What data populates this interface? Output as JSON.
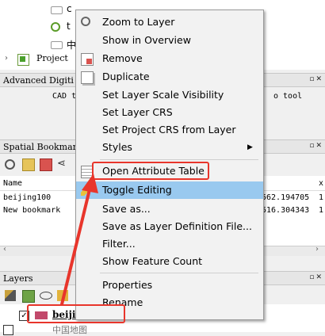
{
  "browser_tree": {
    "items": [
      "c",
      "t",
      "中",
      "Project"
    ]
  },
  "digitizing_panel": {
    "title": "Advanced Digiti",
    "text_left": "CAD t",
    "text_right": "o tool"
  },
  "bookmarks_panel": {
    "title": "Spatial Bookmar",
    "columns": [
      "Name",
      "x"
    ],
    "rows": [
      {
        "name": "beijing100",
        "coord": "562.194705",
        "extra": "1"
      },
      {
        "name": "New bookmark",
        "coord": "516.304343",
        "extra": "1"
      }
    ]
  },
  "layers_panel": {
    "title": "Layers",
    "layer_name": "beijingBorder",
    "layer_next": "中国地图"
  },
  "context_menu": {
    "items": {
      "zoom": "Zoom to Layer",
      "overview": "Show in Overview",
      "remove": "Remove",
      "duplicate": "Duplicate",
      "scale_vis": "Set Layer Scale Visibility",
      "layer_crs": "Set Layer CRS",
      "project_crs": "Set Project CRS from Layer",
      "styles": "Styles",
      "open_table": "Open Attribute Table",
      "toggle_edit": "Toggle Editing",
      "save_as": "Save as...",
      "save_def": "Save as Layer Definition File...",
      "filter": "Filter...",
      "feature_count": "Show Feature Count",
      "properties": "Properties",
      "rename": "Rename"
    }
  },
  "colors": {
    "highlight": "#99c9ef",
    "annotation": "#e8352b"
  }
}
